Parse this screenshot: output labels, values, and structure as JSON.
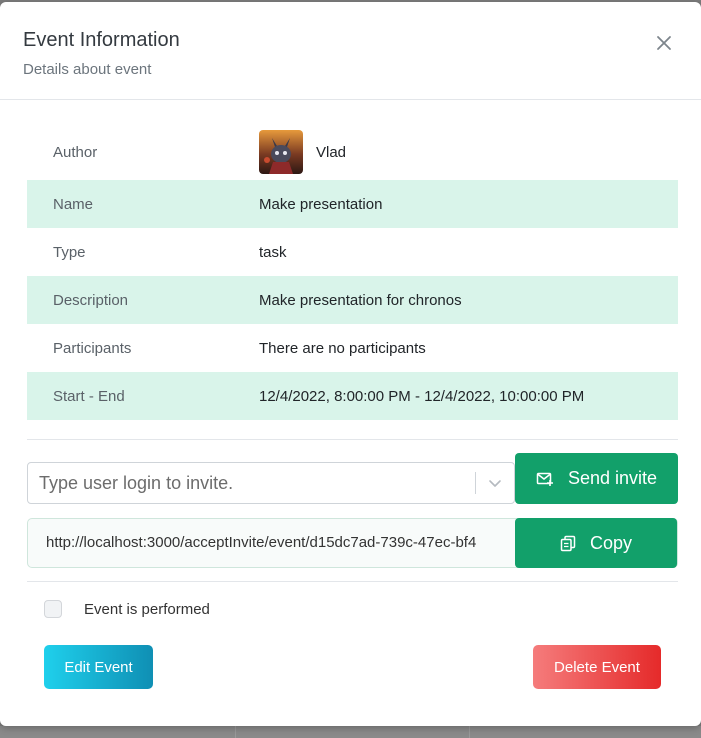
{
  "modal": {
    "title": "Event Information",
    "subtitle": "Details about event",
    "close_icon": "close-icon"
  },
  "info": [
    {
      "label": "Author",
      "value": "Vlad",
      "has_avatar": true
    },
    {
      "label": "Name",
      "value": "Make presentation"
    },
    {
      "label": "Type",
      "value": "task"
    },
    {
      "label": "Description",
      "value": "Make presentation for chronos"
    },
    {
      "label": "Participants",
      "value": "There are no participants"
    },
    {
      "label": "Start - End",
      "value": "12/4/2022, 8:00:00 PM - 12/4/2022, 10:00:00 PM"
    }
  ],
  "invite": {
    "placeholder": "Type user login to invite.",
    "send_label": "Send invite",
    "send_icon": "envelope-plus-icon"
  },
  "link": {
    "url": "http://localhost:3000/acceptInvite/event/d15dc7ad-739c-47ec-bf4",
    "copy_label": "Copy",
    "copy_icon": "copy-icon"
  },
  "performed": {
    "label": "Event is performed",
    "checked": false
  },
  "actions": {
    "edit_label": "Edit Event",
    "delete_label": "Delete Event"
  },
  "colors": {
    "accent_green": "#12a06a",
    "row_stripe": "#d9f4ea",
    "edit_gradient": [
      "#1fd0ec",
      "#0f8fb4"
    ],
    "delete_gradient": [
      "#f57c7c",
      "#e52a2a"
    ]
  }
}
